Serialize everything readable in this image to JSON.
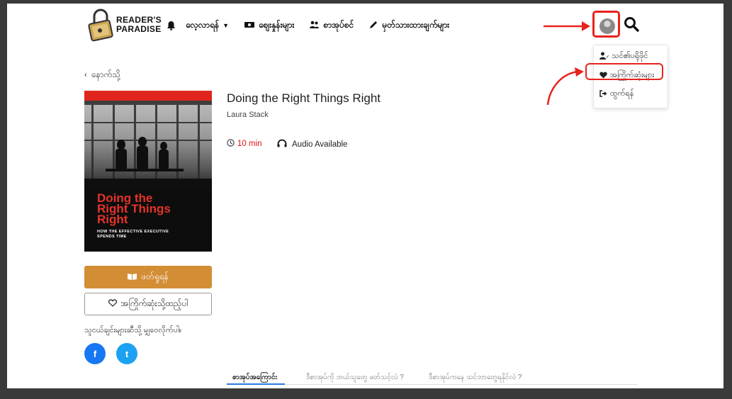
{
  "header": {
    "logo_line1": "READER'S",
    "logo_line2": "PARADISE",
    "nav": [
      {
        "icon": "bell-icon",
        "label": ""
      },
      {
        "icon": "",
        "label": "လေ့လာရန်"
      },
      {
        "icon": "ticket-icon",
        "label": "စျေးနှုန်းများ"
      },
      {
        "icon": "users-icon",
        "label": "စာအုပ်စင်"
      },
      {
        "icon": "pen-icon",
        "label": "မှတ်သားထားချက်များ"
      }
    ]
  },
  "user_menu": {
    "items": [
      {
        "icon": "user-edit-icon",
        "label": "သင်၏ပရိုဖိုင်"
      },
      {
        "icon": "heart-icon",
        "label": "အကြိုက်ဆုံးများ"
      },
      {
        "icon": "logout-icon",
        "label": "ထွက်ရန်"
      }
    ]
  },
  "back_label": "နောက်သို့",
  "book": {
    "title": "Doing the Right Things Right",
    "author": "Laura Stack",
    "duration": "10 min",
    "audio": "Audio Available",
    "cover_title_1": "Doing the",
    "cover_title_2": "Right Things",
    "cover_title_3": "Right",
    "cover_sub_1": "HOW THE EFFECTIVE EXECUTIVE",
    "cover_sub_2": "SPENDS TIME"
  },
  "actions": {
    "read": "ဖတ်ရှုရန်",
    "favorite": "အကြိုက်ဆုံးသို့ထည့်ပါ"
  },
  "share": {
    "label": "သူငယ်ချင်းများဆီသို့ မျှဝေလိုက်ပါ။",
    "facebook": "f",
    "twitter": "t"
  },
  "tabs": [
    "စာအုပ်အကြောင်း",
    "ဒီစာအုပ်ကို ဘယ်သူတွေ ဖတ်သင့်လဲ ?",
    "ဒီစာအုပ်ကနေ သင်ဘာတွေရနိုင်လဲ ?"
  ],
  "colors": {
    "accent": "#d38d35",
    "annotation": "#e8231d",
    "tab_active": "#2a7ae4",
    "facebook": "#1877f2",
    "twitter": "#1da1f2"
  }
}
